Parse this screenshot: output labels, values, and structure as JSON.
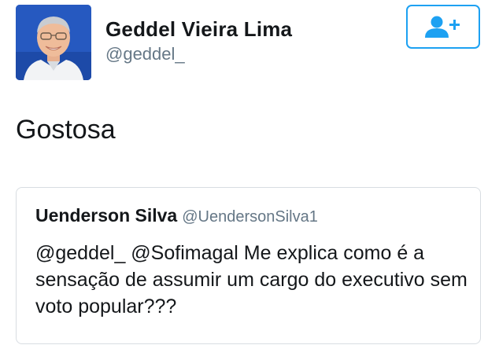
{
  "author": {
    "display_name": "Geddel Vieira Lima",
    "handle": "@geddel_",
    "avatar_icon": "profile-photo"
  },
  "follow_button": {
    "icon": "add-user-icon",
    "color": "#1da1f2"
  },
  "tweet": {
    "text": "Gostosa"
  },
  "quoted_tweet": {
    "display_name": "Uenderson Silva",
    "handle": "@UendersonSilva1",
    "text": "@geddel_ @Sofimagal Me explica como é a sensação de assumir um cargo do executivo sem voto popular???"
  },
  "colors": {
    "primary_text": "#14171a",
    "secondary_text": "#657786",
    "accent": "#1da1f2",
    "card_border": "#d8dde2"
  }
}
